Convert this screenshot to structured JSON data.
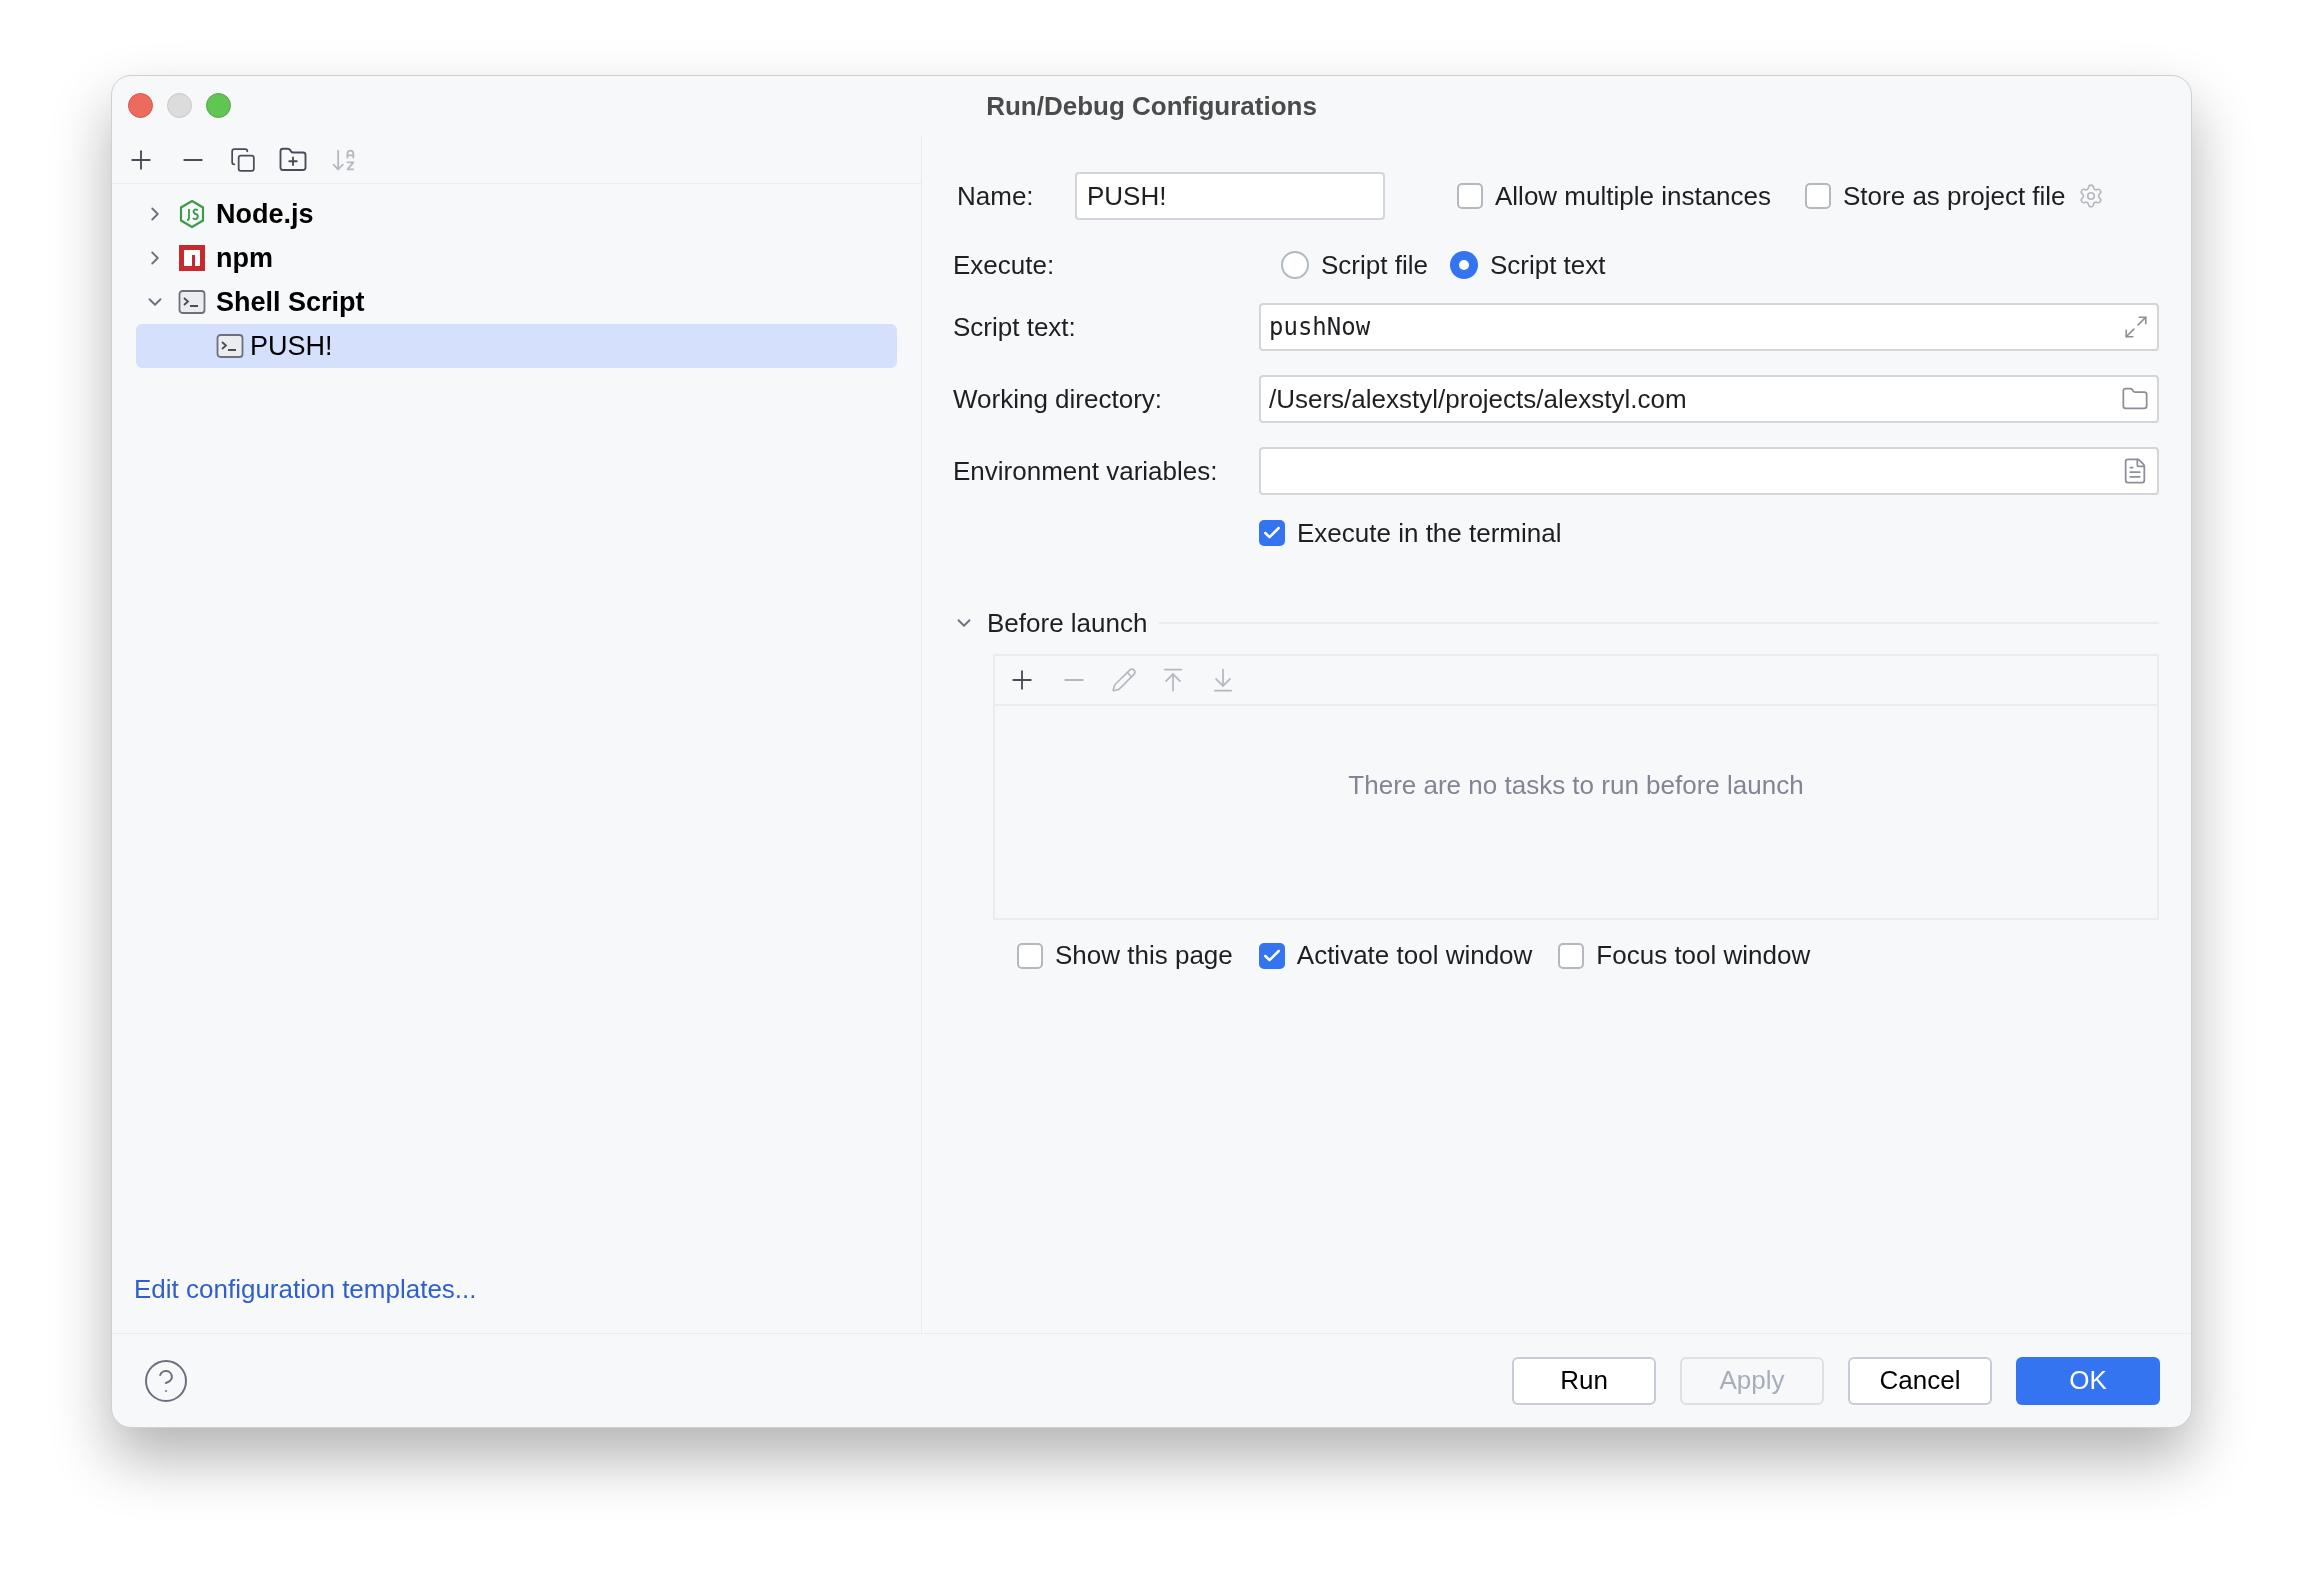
{
  "window": {
    "title": "Run/Debug Configurations"
  },
  "tree": [
    {
      "label": "Node.js",
      "kind": "nodejs",
      "expanded": false,
      "selected": false
    },
    {
      "label": "npm",
      "kind": "npm",
      "expanded": false,
      "selected": false
    },
    {
      "label": "Shell Script",
      "kind": "shell",
      "expanded": true,
      "selected": false,
      "children": [
        {
          "label": "PUSH!",
          "kind": "shell",
          "selected": true
        }
      ]
    }
  ],
  "templates_link": "Edit configuration templates...",
  "name": {
    "label": "Name:",
    "value": "PUSH!"
  },
  "top_options": [
    {
      "label": "Allow multiple instances",
      "checked": false,
      "settings": false
    },
    {
      "label": "Store as project file",
      "checked": false,
      "settings": true
    }
  ],
  "execute": {
    "label": "Execute:",
    "options": [
      {
        "label": "Script file",
        "selected": false
      },
      {
        "label": "Script text",
        "selected": true
      }
    ]
  },
  "fields": [
    {
      "label": "Script text:",
      "value": "pushNow",
      "kind": "expand",
      "mono": true
    },
    {
      "label": "Working directory:",
      "value": "/Users/alexstyl/projects/alexstyl.com",
      "kind": "folder",
      "mono": false
    },
    {
      "label": "Environment variables:",
      "kind": "list"
    }
  ],
  "execute_in_terminal": {
    "label": "Execute in the terminal",
    "checked": true
  },
  "before_launch": {
    "title": "Before launch",
    "expanded": true,
    "empty_text": "There are no tasks to run before launch",
    "options": [
      {
        "label": "Show this page",
        "checked": false
      },
      {
        "label": "Activate tool window",
        "checked": true
      },
      {
        "label": "Focus tool window",
        "checked": false
      }
    ]
  },
  "buttons": [
    {
      "label": "Run",
      "kind": "default",
      "disabled": false
    },
    {
      "label": "Apply",
      "kind": "default",
      "disabled": true
    },
    {
      "label": "Cancel",
      "kind": "default",
      "disabled": false
    },
    {
      "label": "OK",
      "kind": "primary",
      "disabled": false
    }
  ]
}
